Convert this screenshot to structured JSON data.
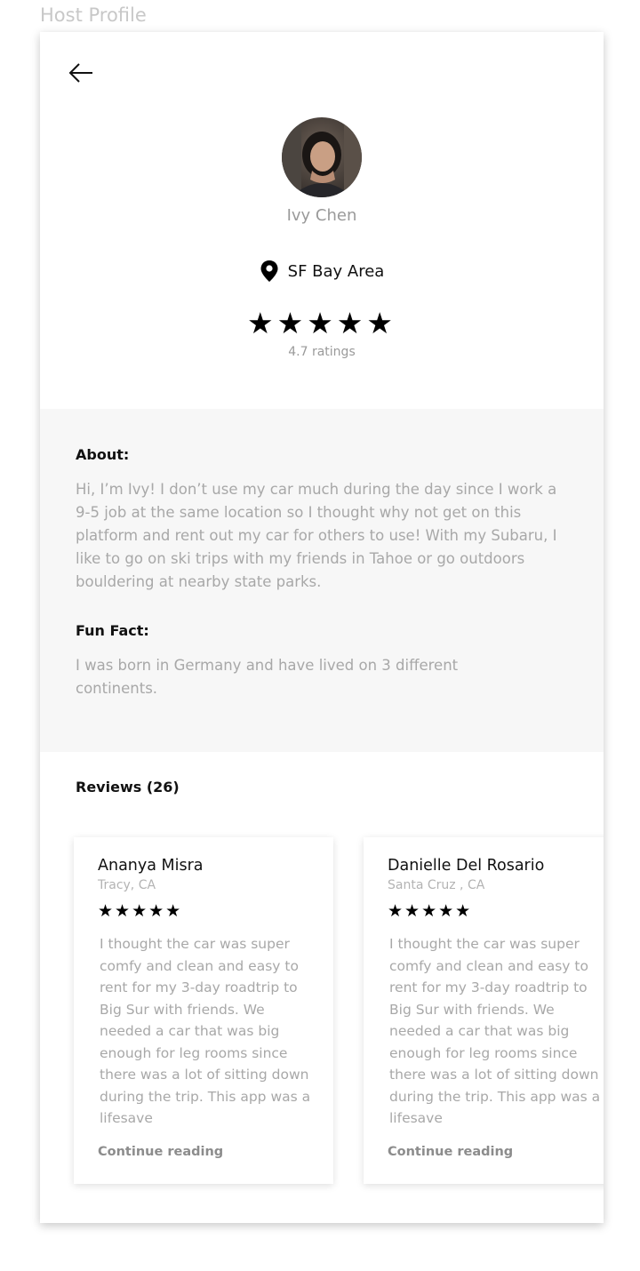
{
  "frame_title": "Host Profile",
  "header": {
    "back_icon": "arrow-left-icon"
  },
  "profile": {
    "name": "Ivy Chen",
    "location": "SF Bay Area",
    "location_icon": "map-pin-icon",
    "stars": "★★★★★",
    "ratings_text": "4.7 ratings"
  },
  "about": {
    "heading": "About:",
    "text": "Hi, I’m Ivy! I don’t use my car much during the day since I work a 9-5 job at the same location so I thought why not get on this platform and rent out my car for others to use! With my Subaru, I like to go on ski trips with my friends in Tahoe or go outdoors bouldering at nearby state parks.",
    "fun_fact_heading": "Fun Fact:",
    "fun_fact_text": "I was born in Germany and have lived on 3 different continents."
  },
  "reviews": {
    "heading": "Reviews (26)",
    "items": [
      {
        "name": "Ananya Misra",
        "location": "Tracy, CA",
        "stars": "★★★★★",
        "text": "I thought the car was super comfy and clean and easy to rent for my 3-day roadtrip to Big Sur with friends. We needed a car that was big enough for leg rooms since there was a lot of sitting down during the trip. This app was a lifesave",
        "continue_label": "Continue reading"
      },
      {
        "name": "Danielle Del Rosario",
        "location": "Santa Cruz , CA",
        "stars": "★★★★★",
        "text": "I thought the car was super comfy and clean and easy to rent for my 3-day roadtrip to Big Sur with friends. We needed a car that was big enough for leg rooms since there was a lot of sitting down during the trip. This app was a lifesave",
        "continue_label": "Continue reading"
      }
    ]
  },
  "colors": {
    "about_background": "#f7f7f7",
    "muted_text": "#a8a8a8",
    "primary_text": "#111111"
  }
}
